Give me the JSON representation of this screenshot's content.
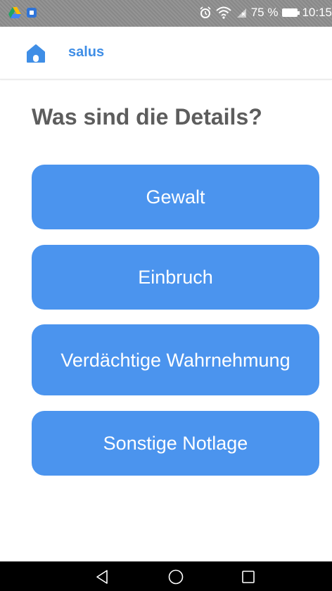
{
  "status_bar": {
    "battery_percent": "75 %",
    "time": "10:15",
    "icons": [
      "drive-icon",
      "notification-icon",
      "alarm-icon",
      "wifi-icon",
      "no-signal-icon",
      "battery-icon"
    ]
  },
  "header": {
    "app_name": "salus",
    "icon": "home-icon",
    "accent_color": "#3f8ee6"
  },
  "main": {
    "title": "Was sind die Details?",
    "button_color": "#4b94ee",
    "options": [
      {
        "label": "Gewalt"
      },
      {
        "label": "Einbruch"
      },
      {
        "label": "Verdächtige Wahrnehmung"
      },
      {
        "label": "Sonstige Notlage"
      }
    ]
  },
  "nav_bar": {
    "icons": [
      "back-icon",
      "home-circle-icon",
      "recents-icon"
    ]
  }
}
